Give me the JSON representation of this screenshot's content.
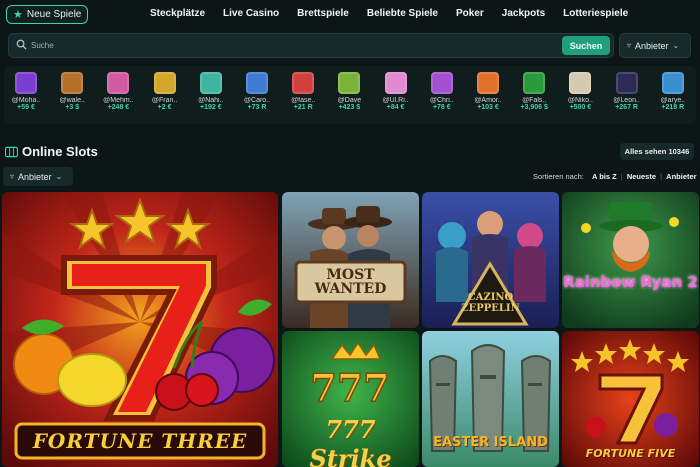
{
  "nav": {
    "new_games": "Neue Spiele",
    "links": [
      "Steckplätze",
      "Live Casino",
      "Brettspiele",
      "Beliebte Spiele",
      "Poker",
      "Jackpots",
      "Lotteriespiele"
    ]
  },
  "search": {
    "placeholder": "Suche",
    "button": "Suchen",
    "provider": "Anbieter"
  },
  "winners": [
    {
      "user": "@Moha..",
      "amount": "+59 €",
      "color": "#7a3fd1"
    },
    {
      "user": "@wale..",
      "amount": "+3 $",
      "color": "#b6702a"
    },
    {
      "user": "@Mehm..",
      "amount": "+248 €",
      "color": "#d15aa0"
    },
    {
      "user": "@Fran..",
      "amount": "+2 €",
      "color": "#d4a72c"
    },
    {
      "user": "@Nahi..",
      "amount": "+192 €",
      "color": "#3fb5a0"
    },
    {
      "user": "@Caro..",
      "amount": "+73 R",
      "color": "#3f7bd1"
    },
    {
      "user": "@fase..",
      "amount": "+21 R",
      "color": "#d13f3f"
    },
    {
      "user": "@Dave",
      "amount": "+423 $",
      "color": "#7bb33a"
    },
    {
      "user": "@Ul.Ri..",
      "amount": "+84 €",
      "color": "#e08ad0"
    },
    {
      "user": "@Chri..",
      "amount": "+78 €",
      "color": "#a24fd1"
    },
    {
      "user": "@Amor..",
      "amount": "+103 €",
      "color": "#e0702a"
    },
    {
      "user": "@Fals..",
      "amount": "+3,906 $",
      "color": "#2a9a3a"
    },
    {
      "user": "@Niko..",
      "amount": "+500 €",
      "color": "#d6c9b0"
    },
    {
      "user": "@Leon..",
      "amount": "+267 R",
      "color": "#2b2b55"
    },
    {
      "user": "@arye..",
      "amount": "+218 R",
      "color": "#3a8fd1"
    }
  ],
  "section": {
    "title": "Online Slots",
    "see_all": "Alles sehen 10346",
    "provider": "Anbieter",
    "sort_label": "Sortieren nach:",
    "sort_options": [
      "A bis Z",
      "Neueste",
      "Anbieter"
    ]
  },
  "games": [
    {
      "title": "FORTUNE THREE"
    },
    {
      "title": "MOST WANTED"
    },
    {
      "title": "CAZINO ZEPPELIN"
    },
    {
      "title": "Rainbow Ryan 2"
    },
    {
      "title": "777 Strike"
    },
    {
      "title": "EASTER ISLAND"
    },
    {
      "title": "FORTUNE FIVE"
    }
  ]
}
